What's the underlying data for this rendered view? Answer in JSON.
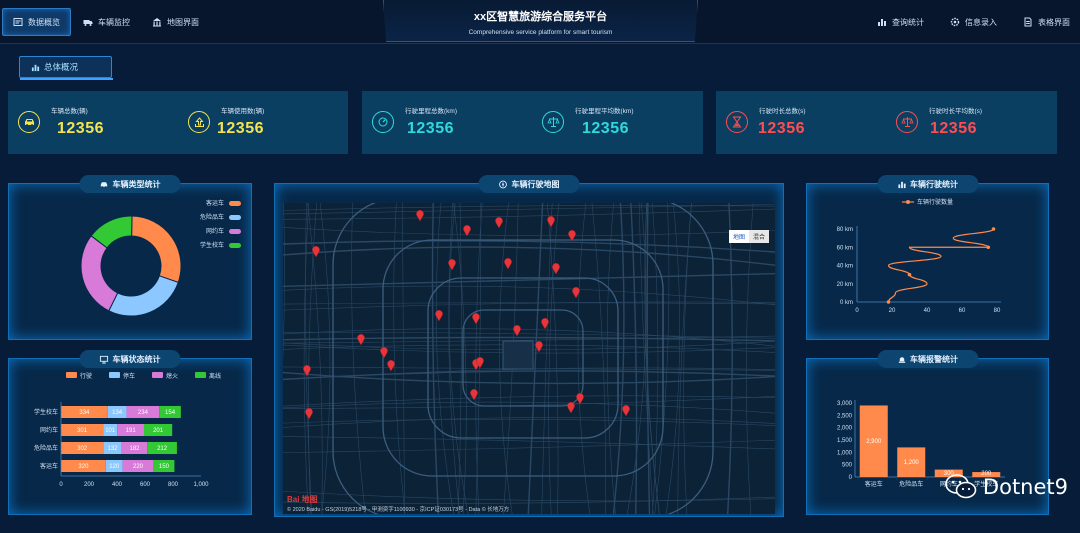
{
  "nav": {
    "left": [
      {
        "label": "数据概览",
        "icon": "dashboard-icon"
      },
      {
        "label": "车辆监控",
        "icon": "truck-icon"
      },
      {
        "label": "地图界面",
        "icon": "building-icon"
      }
    ],
    "right": [
      {
        "label": "查询统计",
        "icon": "bar-chart-icon"
      },
      {
        "label": "信息录入",
        "icon": "gear-icon"
      },
      {
        "label": "表格界面",
        "icon": "document-icon"
      }
    ]
  },
  "header": {
    "title": "xx区智慧旅游综合服务平台",
    "subtitle": "Comprehensive service platform for smart tourism"
  },
  "overview_tab": "总体概况",
  "stats": [
    {
      "label": "车辆总数(辆)",
      "value": "12356",
      "color": "#f6e44f",
      "icon": "car-icon"
    },
    {
      "label": "车辆使用数(辆)",
      "value": "12356",
      "color": "#f6e44f",
      "icon": "upload-icon"
    },
    {
      "label": "行驶里程总数(km)",
      "value": "12356",
      "color": "#2fd9dc",
      "icon": "speedometer-icon"
    },
    {
      "label": "行驶里程平均数(km)",
      "value": "12356",
      "color": "#2fd9dc",
      "icon": "scale-icon"
    },
    {
      "label": "行驶时长总数(s)",
      "value": "12356",
      "color": "#ff4d52",
      "icon": "hourglass-icon"
    },
    {
      "label": "行驶时长平均数(s)",
      "value": "12356",
      "color": "#ff4d52",
      "icon": "scale-icon"
    }
  ],
  "panels": {
    "vehicle_type": "车辆类型统计",
    "vehicle_status": "车辆状态统计",
    "map": "车辆行驶地图",
    "vehicle_driving": "车辆行驶统计",
    "vehicle_alarm": "车辆报警统计"
  },
  "map": {
    "toggle": [
      "地图",
      "混合"
    ],
    "logo": "Bai 地图",
    "copyright": "© 2020 Baidu - GS(2019)5218号 - 甲测资字1100930 - 京ICP证030173号 - Data © 长地万方"
  },
  "watermark": "Dotnet9",
  "colors": {
    "orange": "#ff8a4c",
    "blue": "#8cc7ff",
    "purple": "#d77ad8",
    "green": "#32c935"
  },
  "chart_data": [
    {
      "type": "pie",
      "variant": "donut",
      "categories": [
        "客运车",
        "危险品车",
        "网约车",
        "学生校车"
      ],
      "values": [
        30,
        27,
        28,
        15
      ],
      "legend": "top-right"
    },
    {
      "type": "bar",
      "orientation": "horizontal",
      "stacked": true,
      "categories": [
        "客运车",
        "危险品车",
        "网约车",
        "学生校车"
      ],
      "series": [
        {
          "name": "行驶",
          "values": [
            320,
            302,
            301,
            334
          ]
        },
        {
          "name": "停车",
          "values": [
            120,
            132,
            101,
            134
          ]
        },
        {
          "name": "熄火",
          "values": [
            220,
            182,
            191,
            234
          ]
        },
        {
          "name": "离线",
          "values": [
            150,
            212,
            201,
            154
          ]
        }
      ],
      "x_ticks": [
        "0",
        "200",
        "400",
        "600",
        "800",
        "1,000"
      ],
      "xlim": [
        0,
        1000
      ],
      "legend": "top"
    },
    {
      "type": "line",
      "series": [
        {
          "name": "车辆行驶数量",
          "x": [
            18,
            22,
            40,
            30,
            18,
            48,
            30,
            75,
            55,
            78
          ],
          "y": [
            0,
            10,
            20,
            30,
            40,
            50,
            60,
            60,
            70,
            80
          ]
        }
      ],
      "x_ticks": [
        "0",
        "20",
        "40",
        "60",
        "80"
      ],
      "y_ticks": [
        "0 km",
        "20 km",
        "40 km",
        "60 km",
        "80 km"
      ],
      "xlim": [
        0,
        80
      ],
      "ylim": [
        0,
        80
      ],
      "legend": "top"
    },
    {
      "type": "bar",
      "categories": [
        "客运车",
        "危险品车",
        "网约车",
        "学生校车"
      ],
      "values": [
        2900,
        1200,
        300,
        200
      ],
      "data_labels": [
        "2,900",
        "1,200",
        "300",
        "200"
      ],
      "y_ticks": [
        "0",
        "500",
        "1,000",
        "1,500",
        "2,000",
        "2,500",
        "3,000"
      ],
      "ylim": [
        0,
        3000
      ]
    }
  ]
}
